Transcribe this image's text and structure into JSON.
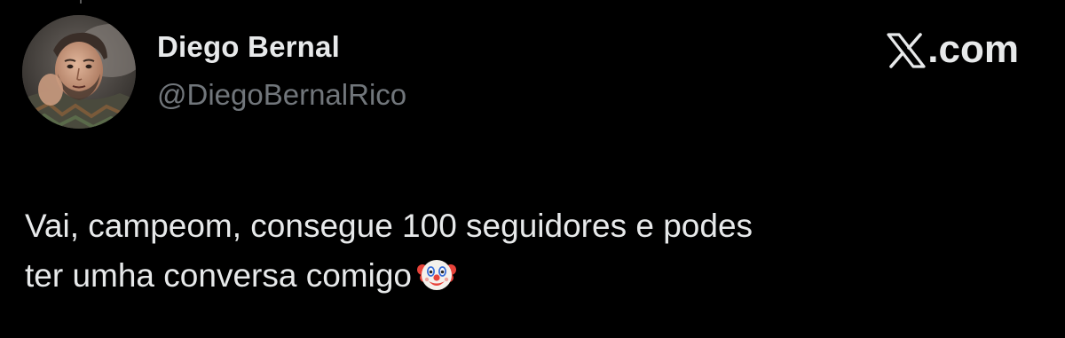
{
  "post": {
    "author": {
      "display_name": "Diego Bernal",
      "handle": "@DiegoBernalRico",
      "avatar_icon": "profile-photo"
    },
    "brand": {
      "label": ".com",
      "icon": "x-logo-icon"
    },
    "text_lines": [
      "Vai, campeom, consegue 100 seguidores e podes",
      "ter umha conversa comigo"
    ],
    "emoji": "clown-face-emoji"
  },
  "colors": {
    "background": "#000000",
    "primary_text": "#e7e9ea",
    "secondary_text": "#71767b"
  }
}
